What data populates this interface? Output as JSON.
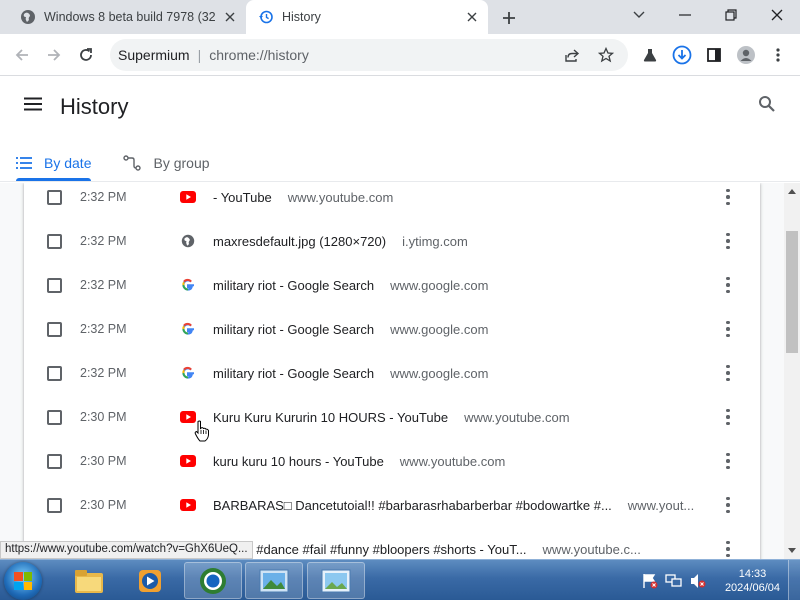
{
  "browser": {
    "tabs": [
      {
        "title": "Windows 8 beta build 7978 (32",
        "icon": "globe-icon",
        "active": false
      },
      {
        "title": "History",
        "icon": "history-icon",
        "active": true
      }
    ],
    "omnibox": {
      "site": "Supermium",
      "url": "chrome://history"
    }
  },
  "page": {
    "title": "History",
    "tabs": [
      {
        "label": "By date",
        "icon": "list-icon",
        "active": true
      },
      {
        "label": "By group",
        "icon": "group-icon",
        "active": false
      }
    ]
  },
  "history": [
    {
      "time": "2:32 PM",
      "favicon": "youtube",
      "title": "- YouTube",
      "domain": "www.youtube.com"
    },
    {
      "time": "2:32 PM",
      "favicon": "globe",
      "title": "maxresdefault.jpg (1280×720)",
      "domain": "i.ytimg.com"
    },
    {
      "time": "2:32 PM",
      "favicon": "google",
      "title": "military riot - Google Search",
      "domain": "www.google.com"
    },
    {
      "time": "2:32 PM",
      "favicon": "google",
      "title": "military riot - Google Search",
      "domain": "www.google.com"
    },
    {
      "time": "2:32 PM",
      "favicon": "google",
      "title": "military riot - Google Search",
      "domain": "www.google.com"
    },
    {
      "time": "2:30 PM",
      "favicon": "youtube",
      "title": "Kuru Kuru Kururin 10 HOURS - YouTube",
      "domain": "www.youtube.com"
    },
    {
      "time": "2:30 PM",
      "favicon": "youtube",
      "title": "kuru kuru 10 hours - YouTube",
      "domain": "www.youtube.com"
    },
    {
      "time": "2:30 PM",
      "favicon": "youtube",
      "title": "BARBARAS□ Dancetutoial!! #barbarasrhabarberbar #bodowartke #...",
      "domain": "www.yout..."
    },
    {
      "time": "2:30 PM",
      "favicon": "youtube",
      "title": "TE! □ - #dance #fail #funny #bloopers #shorts - YouT...",
      "domain": "www.youtube.c..."
    }
  ],
  "status_url": "https://www.youtube.com/watch?v=GhX6UeQ...",
  "taskbar": {
    "time": "14:33",
    "date": "2024/06/04"
  },
  "colors": {
    "accent": "#1a73e8",
    "youtube_red": "#ff0000"
  }
}
